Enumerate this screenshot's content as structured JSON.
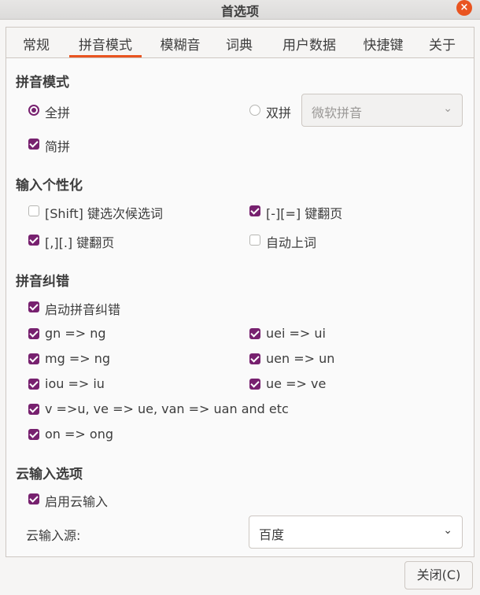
{
  "window": {
    "title": "首选项",
    "close_icon": "×"
  },
  "tabs": [
    "常规",
    "拼音模式",
    "模糊音",
    "词典",
    "用户数据",
    "快捷键",
    "关于"
  ],
  "pinyin_mode": {
    "heading": "拼音模式",
    "full_pinyin": "全拼",
    "double_pinyin": "双拼",
    "double_scheme": "微软拼音",
    "incomplete": "简拼"
  },
  "personalize": {
    "heading": "输入个性化",
    "shift_select": "[Shift] 键选次候选词",
    "minus_equal_page": "[-][=] 键翻页",
    "comma_period_page": "[,][.] 键翻页",
    "auto_learn": "自动上词"
  },
  "correction": {
    "heading": "拼音纠错",
    "enable": "启动拼音纠错",
    "gn_ng": "gn => ng",
    "uei_ui": "uei => ui",
    "mg_ng": "mg => ng",
    "uen_un": "uen => un",
    "iou_iu": "iou => iu",
    "ue_ve": "ue => ve",
    "v_u": "v =>u, ve => ue, van => uan and etc",
    "on_ong": "on => ong"
  },
  "cloud": {
    "heading": "云输入选项",
    "enable": "启用云输入",
    "source_label": "云输入源:",
    "source_value": "百度"
  },
  "chevron": "⌄",
  "close_button": "关闭(C)"
}
